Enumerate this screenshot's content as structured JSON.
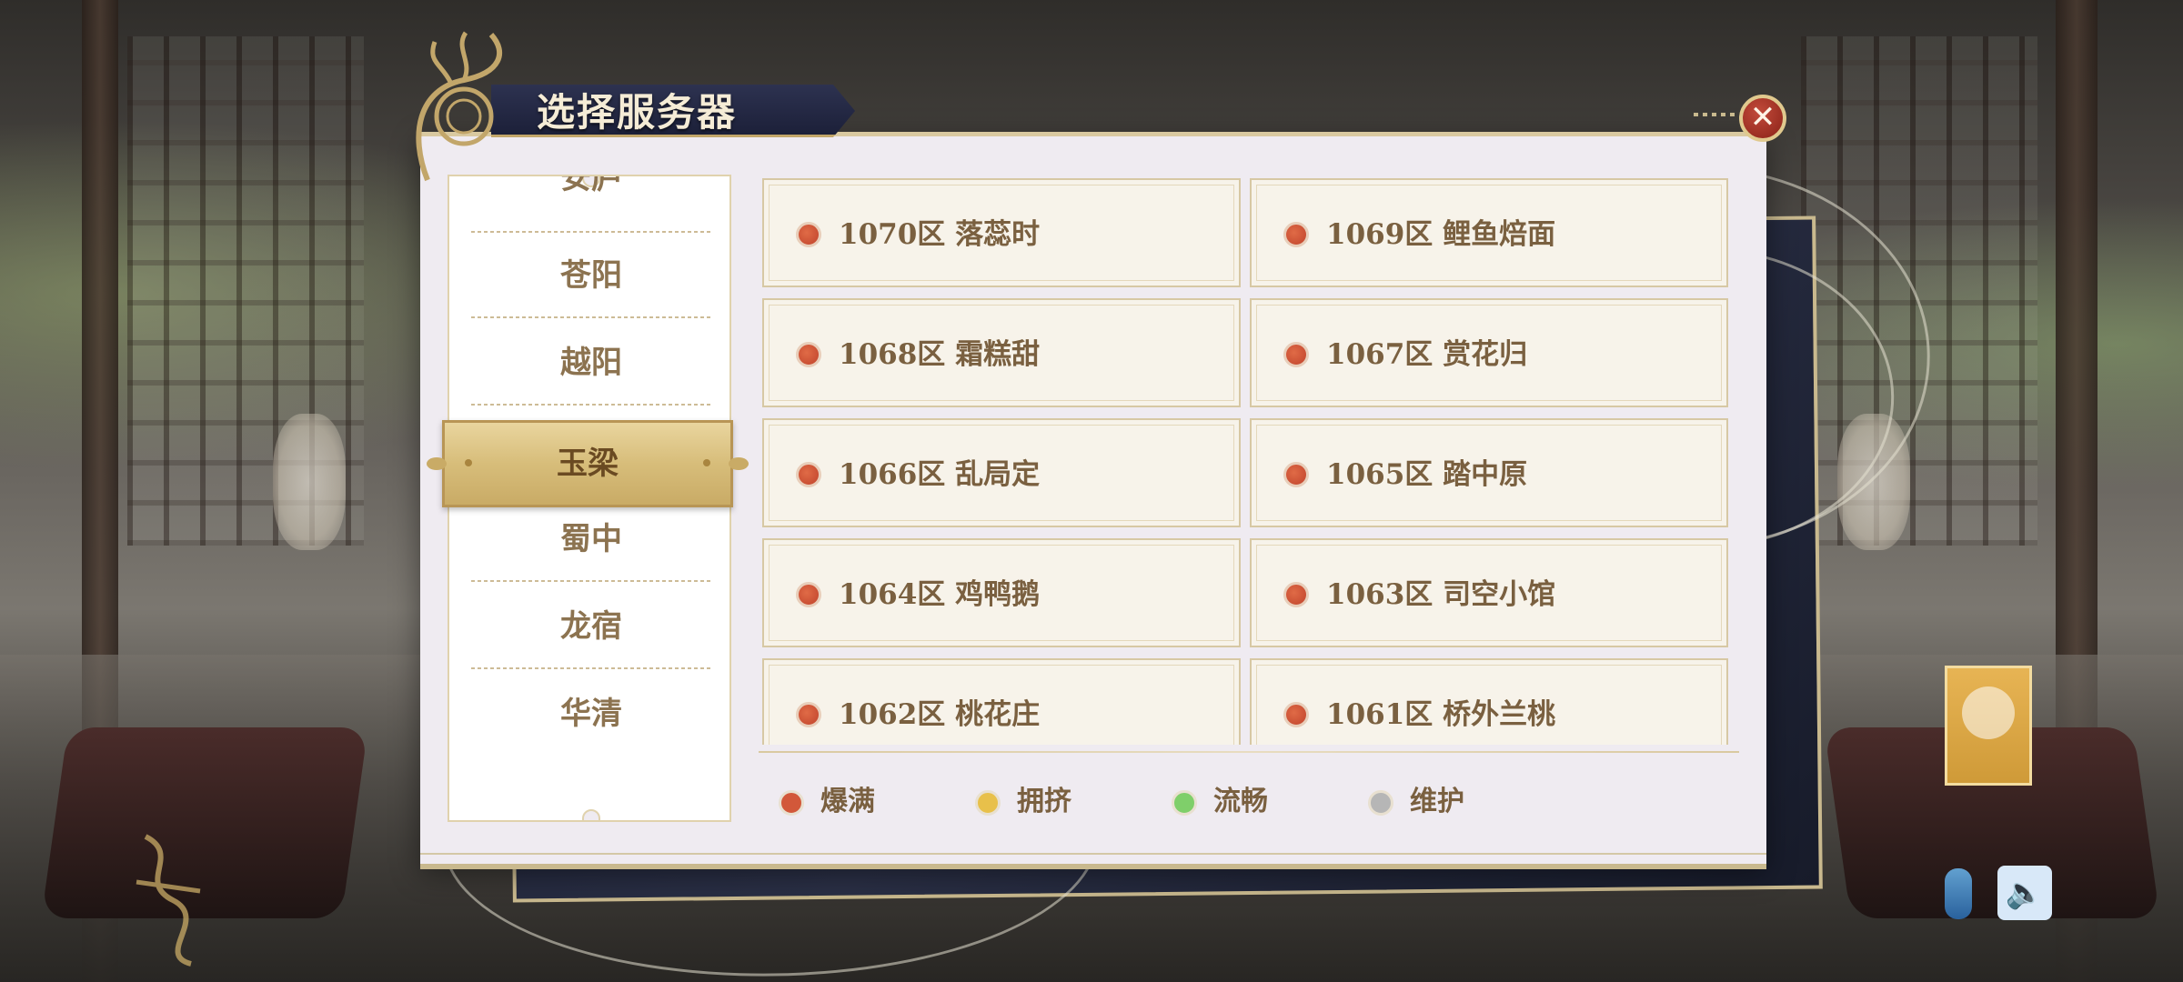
{
  "dialog": {
    "title": "选择服务器",
    "close_label": "✕"
  },
  "regions": {
    "items": [
      {
        "label": "安庐"
      },
      {
        "label": "苍阳"
      },
      {
        "label": "越阳"
      },
      {
        "label": "玉梁"
      },
      {
        "label": "蜀中"
      },
      {
        "label": "龙宿"
      },
      {
        "label": "华清"
      }
    ],
    "selected": "玉梁"
  },
  "servers": [
    {
      "label": "1070区 落蕊时",
      "status": "爆满"
    },
    {
      "label": "1069区 鲤鱼焙面",
      "status": "爆满"
    },
    {
      "label": "1068区 霜糕甜",
      "status": "爆满"
    },
    {
      "label": "1067区 赏花归",
      "status": "爆满"
    },
    {
      "label": "1066区 乱局定",
      "status": "爆满"
    },
    {
      "label": "1065区 踏中原",
      "status": "爆满"
    },
    {
      "label": "1064区 鸡鸭鹅",
      "status": "爆满"
    },
    {
      "label": "1063区 司空小馆",
      "status": "爆满"
    },
    {
      "label": "1062区 桃花庄",
      "status": "爆满"
    },
    {
      "label": "1061区 桥外兰桃",
      "status": "爆满"
    }
  ],
  "legend": [
    {
      "label": "爆满",
      "color": "#d2583a"
    },
    {
      "label": "拥挤",
      "color": "#e8c04a"
    },
    {
      "label": "流畅",
      "color": "#7fcf6a"
    },
    {
      "label": "维护",
      "color": "#b6b6b6"
    }
  ],
  "colors": {
    "status_full": "#d2583a",
    "accent_gold": "#c9ab66",
    "text_brown": "#7a6040"
  },
  "icons": {
    "close": "close-icon",
    "sound": "speaker-icon",
    "mic": "mic-icon"
  }
}
